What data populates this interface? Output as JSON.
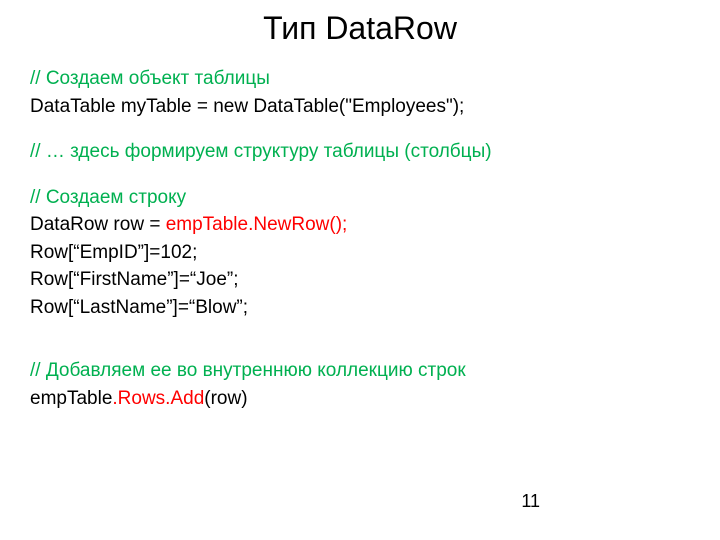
{
  "title": "Тип DataRow",
  "lines": {
    "c1": "// Создаем объект таблицы",
    "l1": "DataTable myTable = new DataTable(\"Employees\");",
    "c2": "// … здесь формируем структуру таблицы (столбцы)",
    "c3": "// Создаем строку",
    "l2a": "DataRow row = ",
    "l2b": "empTable.NewRow();",
    "l3": "Row[“EmpID”]=102;",
    "l4": "Row[“FirstName”]=“Joe”;",
    "l5": "Row[“LastName”]=“Blow”;",
    "c4": "// Добавляем ее во внутреннюю коллекцию строк",
    "l6a": "empTable",
    "l6b": ".Rows.Add",
    "l6c": "(row)"
  },
  "page_number": "11"
}
